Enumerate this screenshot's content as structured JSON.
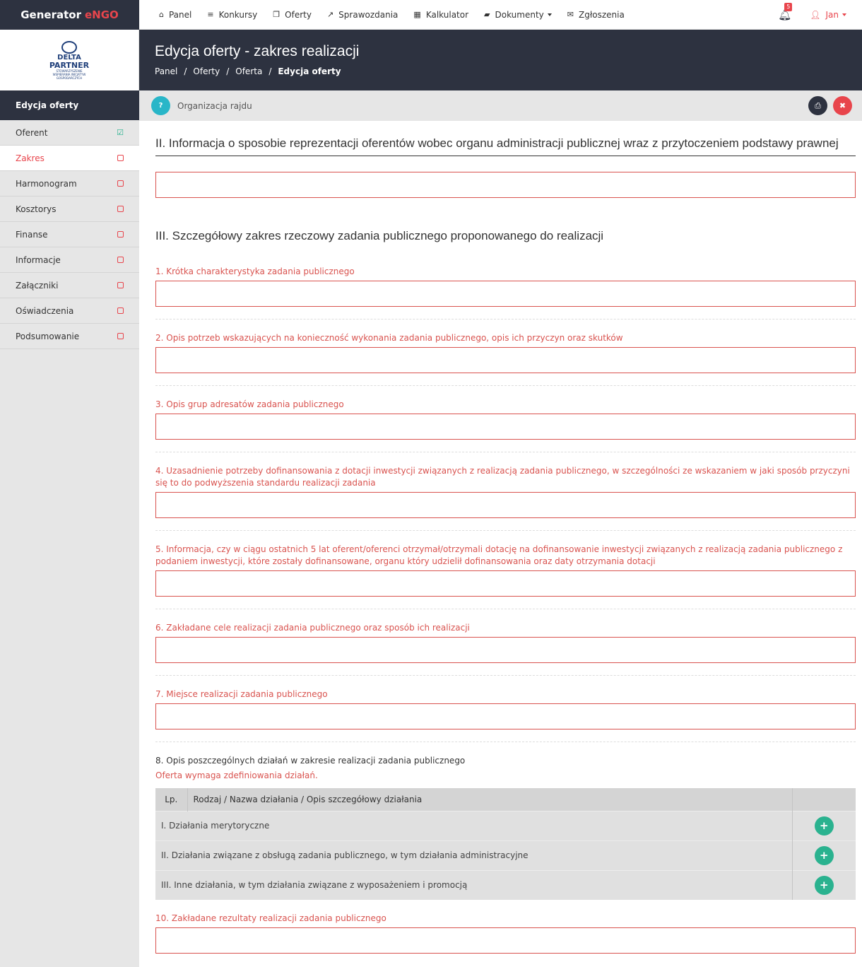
{
  "brand": {
    "name": "Generator",
    "accent": "eNGO"
  },
  "nav": [
    {
      "icon": "home-icon",
      "glyph": "⌂",
      "label": "Panel"
    },
    {
      "icon": "list-icon",
      "glyph": "≡",
      "label": "Konkursy"
    },
    {
      "icon": "copy-icon",
      "glyph": "❐",
      "label": "Oferty"
    },
    {
      "icon": "external-link-icon",
      "glyph": "↗",
      "label": "Sprawozdania"
    },
    {
      "icon": "calculator-icon",
      "glyph": "▦",
      "label": "Kalkulator"
    },
    {
      "icon": "folder-icon",
      "glyph": "▰",
      "label": "Dokumenty"
    },
    {
      "icon": "envelope-icon",
      "glyph": "✉",
      "label": "Zgłoszenia"
    }
  ],
  "notifications": {
    "count": "5"
  },
  "user": {
    "name": "Jan"
  },
  "logo": {
    "line1": "DELTA",
    "line2": "PARTNER",
    "line3": "STOWARZYSZENIE WSPIERANIA INICJATYW GOSPODARCZYCH"
  },
  "sidebar": {
    "heading": "Edycja oferty",
    "items": [
      {
        "label": "Oferent",
        "status": "done"
      },
      {
        "label": "Zakres",
        "status": "active"
      },
      {
        "label": "Harmonogram",
        "status": "todo"
      },
      {
        "label": "Kosztorys",
        "status": "todo"
      },
      {
        "label": "Finanse",
        "status": "todo"
      },
      {
        "label": "Informacje",
        "status": "todo"
      },
      {
        "label": "Załączniki",
        "status": "todo"
      },
      {
        "label": "Oświadczenia",
        "status": "todo"
      },
      {
        "label": "Podsumowanie",
        "status": "todo"
      }
    ]
  },
  "header": {
    "title": "Edycja oferty - zakres realizacji",
    "breadcrumb": [
      "Panel",
      "Oferty",
      "Oferta",
      "Edycja oferty"
    ]
  },
  "subbar": {
    "help": "?",
    "title": "Organizacja rajdu"
  },
  "section2": {
    "title": "II. Informacja o sposobie reprezentacji oferentów wobec organu administracji publicznej wraz z przytoczeniem podstawy prawnej"
  },
  "section3": {
    "title": "III. Szczegółowy zakres rzeczowy zadania publicznego proponowanego do realizacji",
    "fields": [
      "1. Krótka charakterystyka zadania publicznego",
      "2. Opis potrzeb wskazujących na konieczność wykonania zadania publicznego, opis ich przyczyn oraz skutków",
      "3. Opis grup adresatów zadania publicznego",
      "4. Uzasadnienie potrzeby dofinansowania z dotacji inwestycji związanych z realizacją zadania publicznego, w szczególności ze wskazaniem w jaki sposób przyczyni się to do podwyższenia standardu realizacji zadania",
      "5. Informacja, czy w ciągu ostatnich 5 lat oferent/oferenci otrzymał/otrzymali dotację na dofinansowanie inwestycji związanych z realizacją zadania publicznego z podaniem inwestycji, które zostały dofinansowane, organu który udzielił dofinansowania oraz daty otrzymania dotacji",
      "6. Zakładane cele realizacji zadania publicznego oraz sposób ich realizacji",
      "7. Miejsce realizacji zadania publicznego"
    ],
    "actions": {
      "title": "8. Opis poszczególnych działań w zakresie realizacji zadania publicznego",
      "warning": "Oferta wymaga zdefiniowania działań.",
      "col_lp": "Lp.",
      "col_name": "Rodzaj / Nazwa działania / Opis szczegółowy działania",
      "rows": [
        "I. Działania merytoryczne",
        "II. Działania związane z obsługą zadania publicznego, w tym działania administracyjne",
        "III. Inne działania, w tym działania związane z wyposażeniem i promocją"
      ]
    },
    "results": "10. Zakładane rezultaty realizacji zadania publicznego"
  }
}
